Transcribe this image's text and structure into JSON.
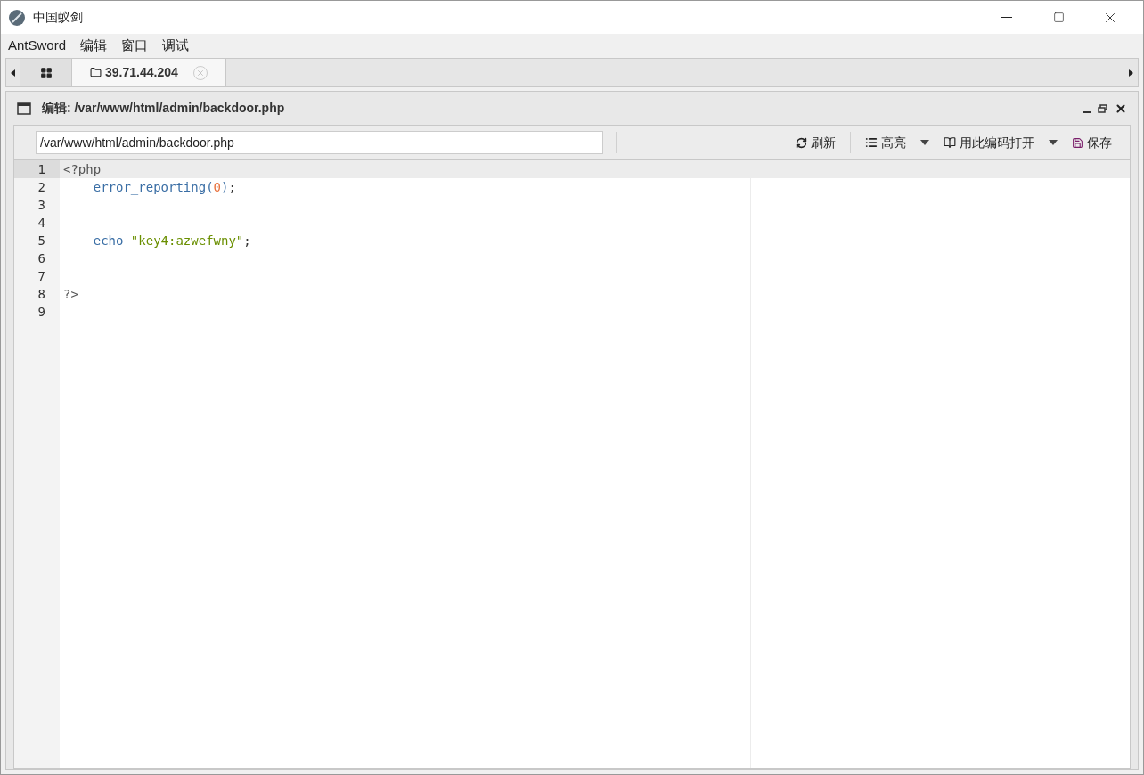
{
  "window": {
    "title": "中国蚁剑"
  },
  "menu": [
    "AntSword",
    "编辑",
    "窗口",
    "调试"
  ],
  "tabs": [
    {
      "kind": "grid",
      "selected": false
    },
    {
      "kind": "folder",
      "label": "39.71.44.204",
      "selected": true
    }
  ],
  "panel": {
    "title": "编辑: /var/www/html/admin/backdoor.php"
  },
  "toolbar": {
    "path_value": "/var/www/html/admin/backdoor.php",
    "buttons": [
      {
        "kind": "refresh",
        "label": "刷新",
        "dropdown": false
      },
      {
        "kind": "highlight",
        "label": "高亮",
        "dropdown": true
      },
      {
        "kind": "encoding",
        "label": "用此编码打开",
        "dropdown": true
      },
      {
        "kind": "save",
        "label": "保存",
        "dropdown": false
      }
    ]
  },
  "editor": {
    "lines": [
      {
        "number": "1",
        "selected": true,
        "tokens": [
          {
            "kind": "tag",
            "text": "<?php"
          }
        ]
      },
      {
        "number": "2",
        "selected": false,
        "tokens": [
          {
            "kind": "function",
            "text": "    error_reporting("
          },
          {
            "kind": "number",
            "text": "0"
          },
          {
            "kind": "function",
            "text": ")"
          },
          {
            "kind": "plain",
            "text": ";"
          }
        ]
      },
      {
        "number": "3",
        "selected": false
      },
      {
        "number": "4",
        "selected": false
      },
      {
        "number": "5",
        "selected": false,
        "tokens": [
          {
            "kind": "function",
            "text": "    echo "
          },
          {
            "kind": "string",
            "text": "\"key4:azwefwny\""
          },
          {
            "kind": "plain",
            "text": ";"
          }
        ]
      },
      {
        "number": "6",
        "selected": false
      },
      {
        "number": "7",
        "selected": false
      },
      {
        "number": "8",
        "selected": false,
        "tokens": [
          {
            "kind": "tag",
            "text": "?>"
          }
        ]
      },
      {
        "number": "9",
        "selected": false
      }
    ]
  }
}
